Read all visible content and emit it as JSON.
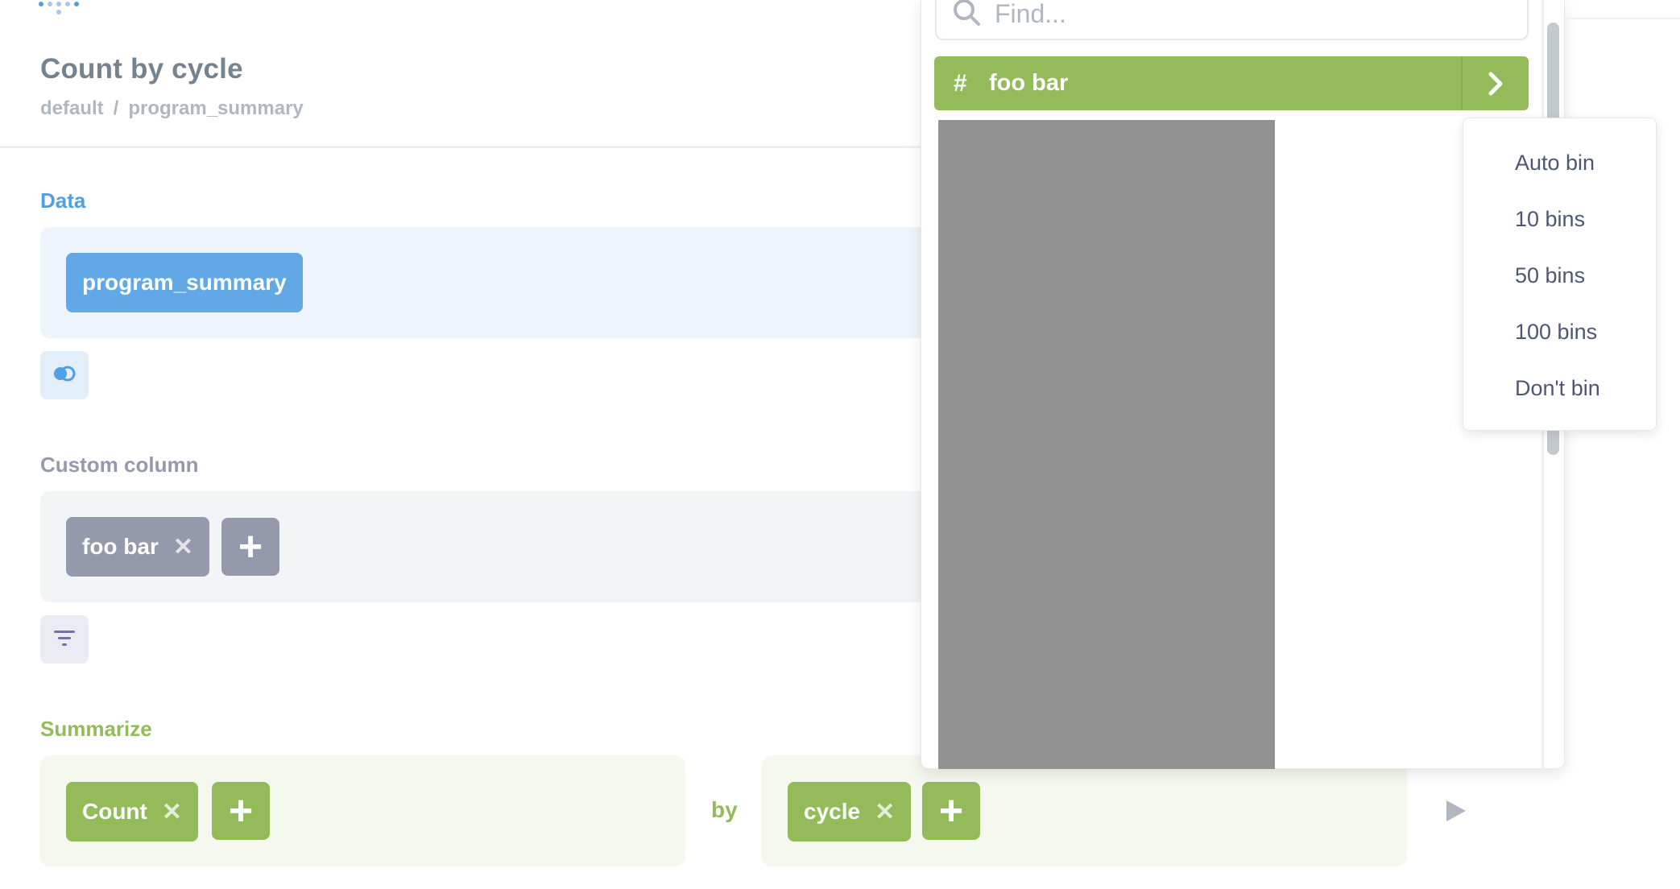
{
  "header": {
    "title": "Count by cycle",
    "breadcrumb": {
      "database": "default",
      "separator": "/",
      "table": "program_summary"
    }
  },
  "data_section": {
    "label": "Data",
    "table_pill": "program_summary",
    "join_icon": "join-icon"
  },
  "custom_column_section": {
    "label": "Custom column",
    "pill": "foo bar",
    "remove": "✕",
    "add": "+",
    "filter_icon": "filter-icon"
  },
  "summarize_section": {
    "label": "Summarize",
    "metric_pill": "Count",
    "remove": "✕",
    "add": "+",
    "by_label": "by",
    "breakout_pill": "cycle"
  },
  "popover": {
    "search_placeholder": "Find...",
    "selected_item": {
      "icon": "#",
      "label": "foo bar"
    }
  },
  "binning_menu": {
    "options": [
      "Auto bin",
      "10 bins",
      "50 bins",
      "100 bins",
      "Don't bin"
    ]
  },
  "colors": {
    "data_accent": "#509ee3",
    "custom_accent": "#949aab",
    "summarize_accent": "#93bb5a",
    "text": "#4c5773"
  }
}
